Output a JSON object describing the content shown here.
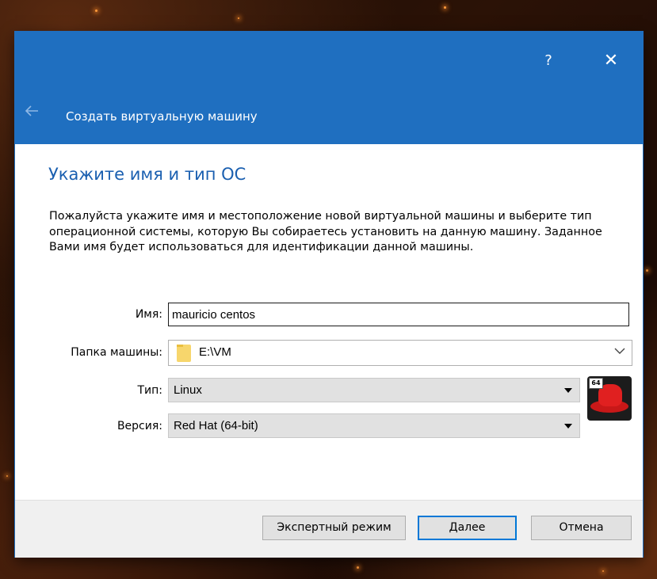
{
  "dialog": {
    "help_label": "?",
    "close_label": "✕",
    "back_icon": "back-arrow-icon",
    "title": "Создать виртуальную машину"
  },
  "page": {
    "heading": "Укажите имя и тип ОС",
    "description": "Пожалуйста укажите имя и местоположение новой виртуальной машины и выберите тип операционной системы, которую Вы собираетесь установить на данную машину. Заданное Вами имя будет использоваться для идентификации данной машины."
  },
  "form": {
    "name_label": "Имя:",
    "name_value": "mauricio centos",
    "folder_label": "Папка машины:",
    "folder_value": "E:\\VM",
    "type_label": "Тип:",
    "type_value": "Linux",
    "version_label": "Версия:",
    "version_value": "Red Hat (64-bit)",
    "os_icon": "redhat-64-icon",
    "os_badge": "64"
  },
  "buttons": {
    "expert": "Экспертный режим",
    "next": "Далее",
    "cancel": "Отмена"
  },
  "colors": {
    "titlebar": "#1f6fc0",
    "heading": "#1a5fb0",
    "primary_border": "#0078d7"
  }
}
